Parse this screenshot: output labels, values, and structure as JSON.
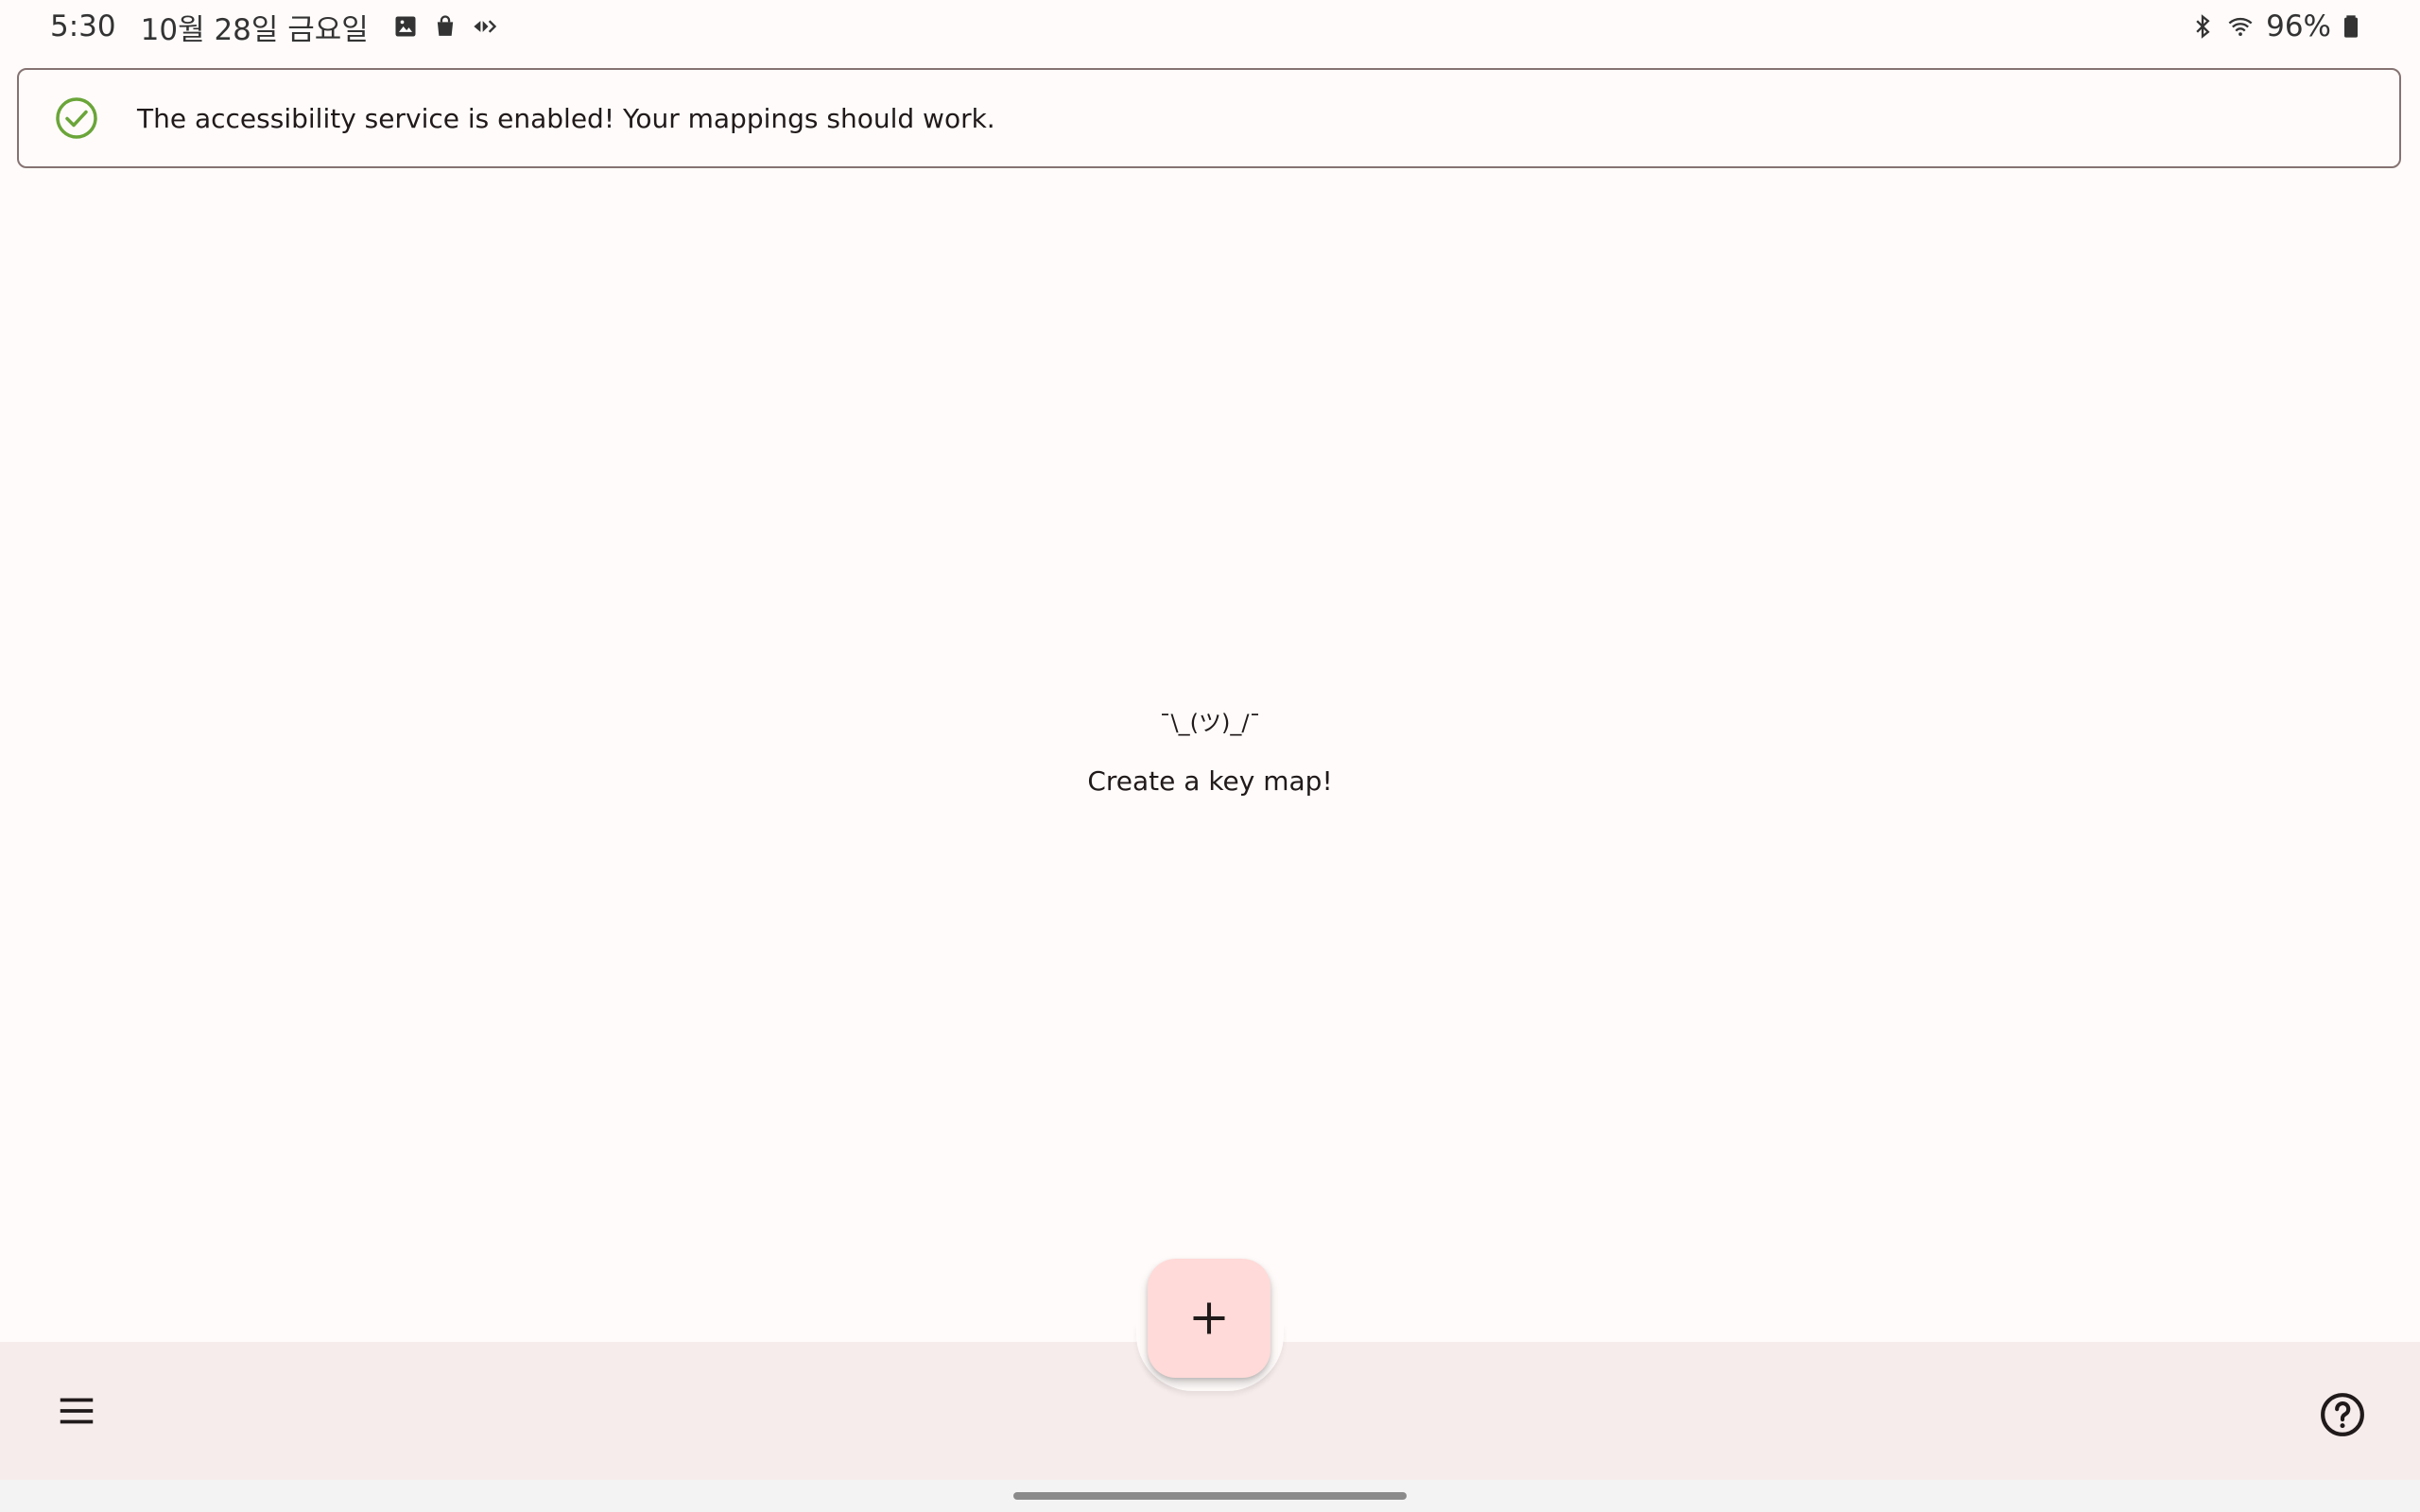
{
  "status_bar": {
    "time": "5:30",
    "date": "10월 28일 금요일",
    "left_icons": [
      "gallery-icon",
      "shopping-bag-icon",
      "cast-icon"
    ],
    "right_icons": [
      "bluetooth-icon",
      "wifi-icon",
      "battery-icon"
    ],
    "battery": "96%"
  },
  "banner": {
    "icon": "check-circle-icon",
    "icon_color": "#6aa539",
    "text": "The accessibility service is enabled! Your mappings should work."
  },
  "empty_state": {
    "emoticon": "¯\\_(ツ)_/¯",
    "message": "Create a key map!"
  },
  "bottom_bar": {
    "menu_icon": "hamburger-menu-icon",
    "help_icon": "help-circle-icon",
    "fab_icon": "plus-icon",
    "background": "#f6ecec",
    "fab_color": "#ffdad8"
  }
}
